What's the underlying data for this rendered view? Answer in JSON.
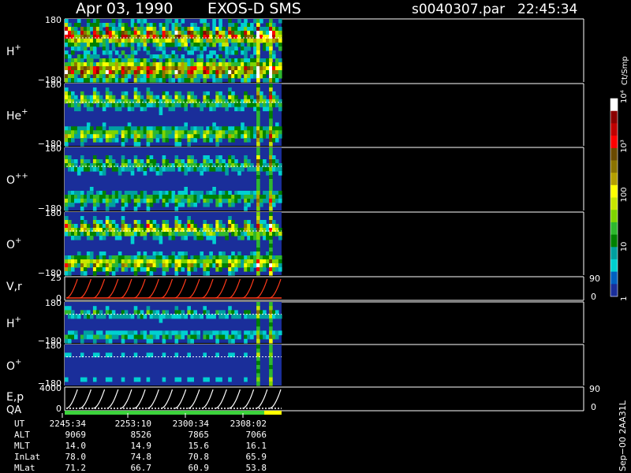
{
  "header": {
    "date": "Apr 03, 1990",
    "instrument": "EXOS-D SMS",
    "file": "s0040307.par",
    "time": "22:45:34"
  },
  "panels": [
    {
      "label": "H",
      "sup": "+",
      "top": "180",
      "bottom": "−180"
    },
    {
      "label": "He",
      "sup": "+",
      "top": "180",
      "bottom": "−180"
    },
    {
      "label": "O",
      "sup": "++",
      "top": "180",
      "bottom": "−180"
    },
    {
      "label": "O",
      "sup": "+",
      "top": "180",
      "bottom": "−180"
    },
    {
      "label": "V,r",
      "sup": "",
      "top": "25",
      "bottom": "0",
      "right_top": "90",
      "right_bottom": "0"
    },
    {
      "label": "H",
      "sup": "+",
      "top": "180",
      "bottom": "−180"
    },
    {
      "label": "O",
      "sup": "+",
      "top": "180",
      "bottom": "−180"
    },
    {
      "label": "E,p",
      "sup": "",
      "top": "4000",
      "bottom": "0",
      "right_top": "90",
      "right_bottom": "0"
    }
  ],
  "qa_label": "QA",
  "colorbar": {
    "unit": "Ct/Smp",
    "tick_labels": [
      "10⁴",
      "10³",
      "100",
      "10",
      "1"
    ],
    "tick_values": [
      10000,
      1000,
      100,
      10,
      1
    ],
    "colors": [
      "#ffffff",
      "#8b0000",
      "#c00000",
      "#ff0000",
      "#6b4a00",
      "#8b7300",
      "#b5a000",
      "#ffff00",
      "#c8e600",
      "#7fd400",
      "#2eb82e",
      "#008000",
      "#00a0a0",
      "#00d0d0",
      "#0060c0",
      "#1a2e9a"
    ]
  },
  "footer": {
    "row_labels": [
      "UT",
      "ALT",
      "MLT",
      "InLat",
      "MLat"
    ],
    "columns": [
      [
        "2245:34",
        "9069",
        "14.0",
        "78.0",
        "71.2"
      ],
      [
        "2253:10",
        "8526",
        "14.9",
        "74.8",
        "66.7"
      ],
      [
        "2300:34",
        "7865",
        "15.6",
        "70.8",
        "60.9"
      ],
      [
        "2308:02",
        "7066",
        "16.1",
        "65.9",
        "53.8"
      ]
    ],
    "side_note": "Sep−00  2AA31L"
  },
  "chart_data": {
    "type": "heatmap",
    "title": "Apr 03, 1990   EXOS-D SMS",
    "x_tick_labels": [
      "2245:34",
      "2253:10",
      "2300:34",
      "2308:02"
    ],
    "data_coverage_fraction": 0.42,
    "color_scale": "log",
    "color_range": [
      1,
      10000
    ],
    "color_unit": "Ct/Smp",
    "panels": [
      {
        "name": "H+",
        "ylim": [
          -180,
          180
        ],
        "intensity": "high"
      },
      {
        "name": "He+",
        "ylim": [
          -180,
          180
        ],
        "intensity": "medium"
      },
      {
        "name": "O++",
        "ylim": [
          -180,
          180
        ],
        "intensity": "low"
      },
      {
        "name": "O+",
        "ylim": [
          -180,
          180
        ],
        "intensity": "medium-high"
      },
      {
        "name": "V,r",
        "ylim": [
          0,
          25
        ],
        "right_ylim": [
          0,
          90
        ],
        "type": "line"
      },
      {
        "name": "H+",
        "ylim": [
          -180,
          180
        ],
        "intensity": "low"
      },
      {
        "name": "O+",
        "ylim": [
          -180,
          180
        ],
        "intensity": "very-low"
      },
      {
        "name": "E,p",
        "ylim": [
          0,
          4000
        ],
        "right_ylim": [
          0,
          90
        ],
        "type": "line"
      }
    ],
    "sawtooth_cycles": 16
  }
}
